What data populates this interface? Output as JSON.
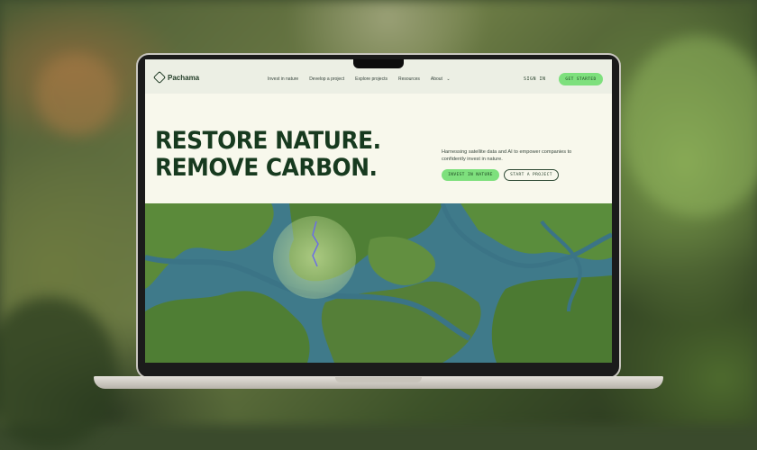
{
  "brand": {
    "name": "Pachama"
  },
  "nav": {
    "links": [
      "Invest in nature",
      "Develop a project",
      "Explore projects",
      "Resources",
      "About"
    ],
    "about_chevron": "⌄",
    "sign_in": "SIGN IN",
    "cta": "GET STARTED"
  },
  "hero": {
    "headline_line1": "RESTORE NATURE.",
    "headline_line2": "REMOVE CARBON.",
    "tagline": "Harnessing satellite data and AI to empower companies to confidently invest in nature.",
    "primary_button": "INVEST IN NATURE",
    "secondary_button": "START A PROJECT"
  },
  "colors": {
    "accent_green": "#7ee07d",
    "headline_dark_green": "#173a1f",
    "hero_background": "#f8f8ec"
  },
  "icons": {
    "logo": "hexagon-logo-icon",
    "dropdown": "chevron-down-icon"
  }
}
